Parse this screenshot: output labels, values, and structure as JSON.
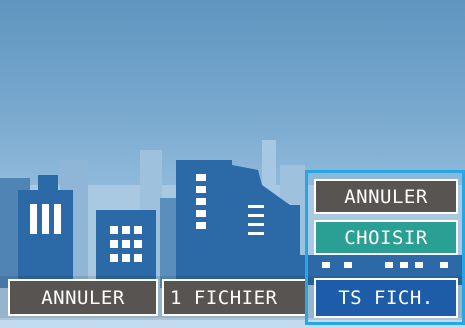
{
  "bottom_bar": {
    "cancel_label": "ANNULER",
    "one_file_label": "1 FICHIER"
  },
  "delete_menu": {
    "cancel_label": "ANNULER",
    "choose_label": "CHOISIR",
    "all_files_label": "TS FICH."
  },
  "colors": {
    "menu_highlight_border": "#27a6e6",
    "selected_item": "#2a9f94",
    "active_option": "#1c5ca8",
    "button_gray": "#575452"
  }
}
